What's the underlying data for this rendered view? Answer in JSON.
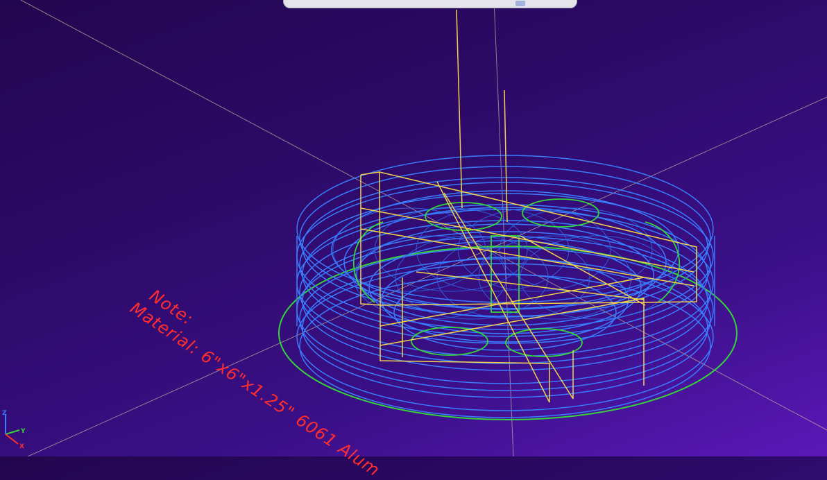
{
  "note": {
    "title": "Note:",
    "material": "Material: 6\"x6\"x1.25\" 6061 Alum"
  },
  "triad": {
    "x_label": "X",
    "y_label": "Y",
    "z_label": "Z"
  },
  "colors": {
    "background": "#2c0a67",
    "toolpath_cut": "#3a7dff",
    "toolpath_rapid": "#f2d34a",
    "toolpath_feed": "#35d43a",
    "note_text": "#ff2e2e",
    "construction_lines": "#b9a8a0"
  },
  "icons": [
    "axis-triad-icon"
  ]
}
